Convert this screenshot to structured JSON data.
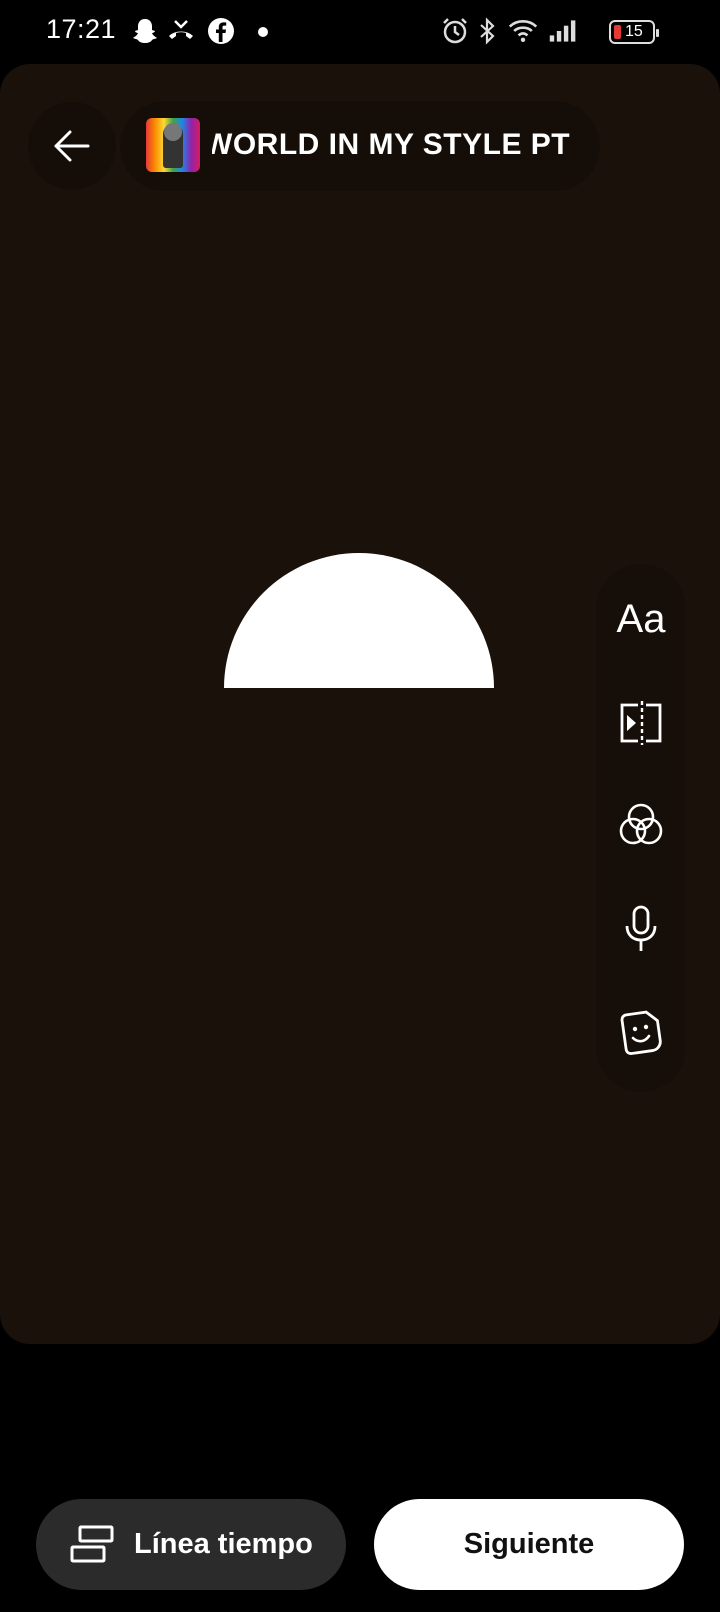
{
  "status_bar": {
    "time": "17:21",
    "battery_level": "15",
    "icons": [
      "snapchat-icon",
      "missed-call-icon",
      "facebook-icon",
      "notification-dot",
      "alarm-icon",
      "bluetooth-icon",
      "wifi-icon",
      "signal-icon",
      "battery-icon"
    ]
  },
  "editor": {
    "audio_track_title": "WORLD IN MY STYLE PT",
    "side_tools": [
      {
        "name": "text-tool",
        "label": "Aa"
      },
      {
        "name": "clips-tool"
      },
      {
        "name": "filters-tool"
      },
      {
        "name": "voiceover-tool"
      },
      {
        "name": "sticker-tool"
      }
    ]
  },
  "footer": {
    "timeline_label": "Línea tiempo",
    "next_label": "Siguiente"
  },
  "colors": {
    "canvas_bg": "#1a110a",
    "button_dark": "#2b2b2b",
    "button_light": "#ffffff"
  }
}
